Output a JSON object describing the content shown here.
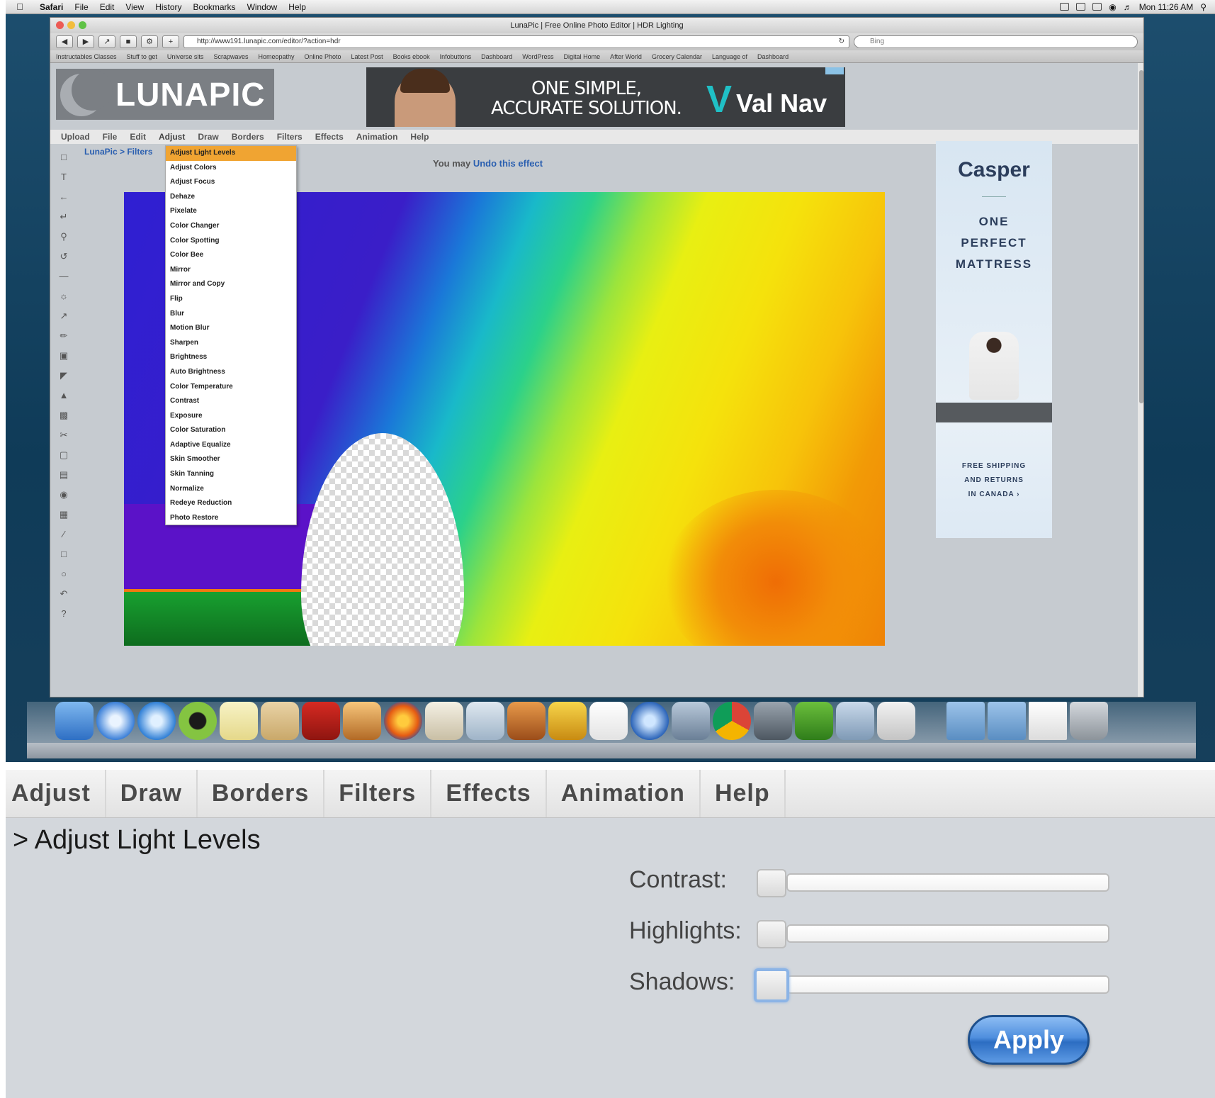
{
  "menubar": {
    "app": "Safari",
    "items": [
      "File",
      "Edit",
      "View",
      "History",
      "Bookmarks",
      "Window",
      "Help"
    ],
    "clock": "Mon 11:26 AM"
  },
  "browser": {
    "title": "LunaPic | Free Online Photo Editor | HDR Lighting",
    "url": "http://www191.lunapic.com/editor/?action=hdr",
    "search_placeholder": "Bing",
    "bookmarks": [
      "Instructables Classes",
      "Stuff to get",
      "Universe sits",
      "Scrapwaves",
      "Homeopathy",
      "Online Photo",
      "Latest Post",
      "Books ebook",
      "Infobuttons",
      "Dashboard",
      "WordPress",
      "Digital Home",
      "After World",
      "Grocery Calendar",
      "Language of",
      "Dashboard"
    ]
  },
  "lunapic": {
    "logo_text": "LUNAPIC",
    "menu": [
      "Upload",
      "File",
      "Edit",
      "Adjust",
      "Draw",
      "Borders",
      "Filters",
      "Effects",
      "Animation",
      "Help"
    ],
    "breadcrumb": "LunaPic > Filters",
    "undo_prefix": "You may",
    "undo_link": "Undo this effect",
    "adjust_menu": {
      "selected": "Adjust Light Levels",
      "items": [
        "Adjust Light Levels",
        "Adjust Colors",
        "Adjust Focus",
        "Dehaze",
        "Pixelate",
        "Color Changer",
        "Color Spotting",
        "Color Bee",
        "Mirror",
        "Mirror and Copy",
        "Flip",
        "Blur",
        "Motion Blur",
        "Sharpen",
        "Brightness",
        "Auto Brightness",
        "Color Temperature",
        "Contrast",
        "Exposure",
        "Color Saturation",
        "Adaptive Equalize",
        "Skin Smoother",
        "Skin Tanning",
        "Normalize",
        "Redeye Reduction",
        "Photo Restore"
      ]
    },
    "top_ad": {
      "tagline_line1": "ONE SIMPLE,",
      "tagline_line2": "ACCURATE SOLUTION.",
      "brand": "Val Nav"
    },
    "side_ad": {
      "brand": "Casper",
      "slogan": [
        "ONE",
        "PERFECT",
        "MATTRESS"
      ],
      "shipping": [
        "FREE SHIPPING",
        "AND RETURNS",
        "IN CANADA ›"
      ]
    }
  },
  "zoom_panel": {
    "menu": [
      "Adjust",
      "Draw",
      "Borders",
      "Filters",
      "Effects",
      "Animation",
      "Help"
    ],
    "breadcrumb": "> Adjust Light Levels",
    "sliders": [
      {
        "label": "Contrast:",
        "value": 0
      },
      {
        "label": "Highlights:",
        "value": 0
      },
      {
        "label": "Shadows:",
        "value": 0
      }
    ],
    "apply_label": "Apply"
  },
  "colors": {
    "menu_highlight": "#f0a432",
    "link_blue": "#2a5fb0",
    "apply_blue": "#2c6dc2"
  }
}
